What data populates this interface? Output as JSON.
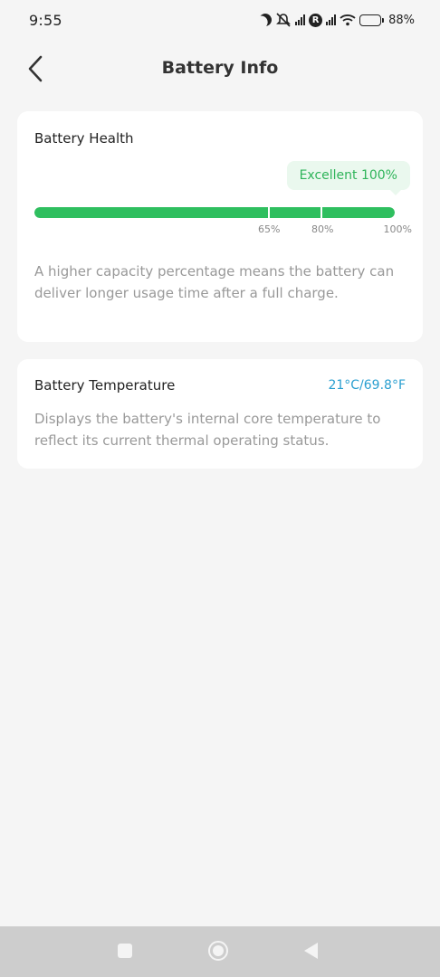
{
  "status_bar": {
    "time": "9:55",
    "battery_percent": "88%",
    "roaming_badge": "R",
    "icons": [
      "moon-icon",
      "silent-icon",
      "signal-icon",
      "roaming-icon",
      "signal-icon",
      "wifi-icon",
      "battery-icon"
    ]
  },
  "header": {
    "title": "Battery Info",
    "back_icon": "chevron-left-icon"
  },
  "health": {
    "title": "Battery Health",
    "badge": "Excellent 100%",
    "level": 1.0,
    "ticks": [
      "65%",
      "80%",
      "100%"
    ],
    "description": "A higher capacity percentage means the battery can deliver longer usage time after a full charge.",
    "accent_color": "#2fbf5f"
  },
  "temperature": {
    "title": "Battery Temperature",
    "value": "21°C/69.8°F",
    "description": "Displays the battery's internal core temperature to reflect its current thermal operating status.",
    "accent_color": "#2a9fd0"
  },
  "nav_bar": {
    "icons": [
      "recents-icon",
      "home-icon",
      "back-icon"
    ]
  }
}
